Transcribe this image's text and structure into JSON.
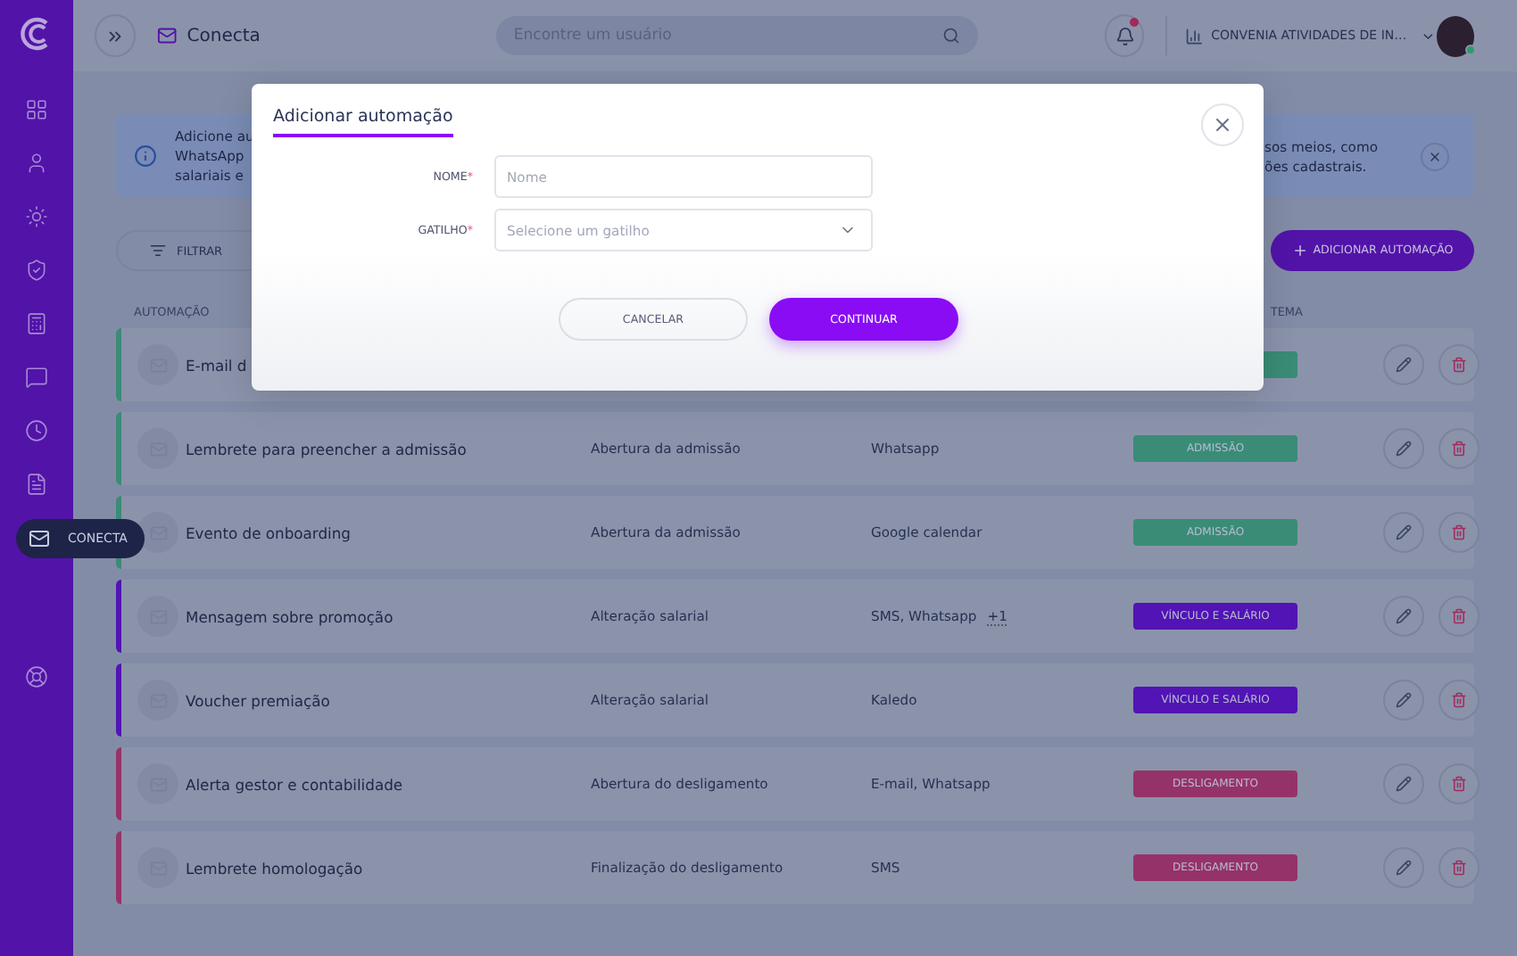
{
  "sidebar": {
    "tooltip": "CONECTA"
  },
  "header": {
    "title": "Conecta",
    "search": {
      "placeholder": "Encontre um usuário"
    },
    "notifications": {
      "unread": true
    },
    "company": "CONVENIA ATIVIDADES DE IN…",
    "avatar": {
      "online": true
    }
  },
  "banner": {
    "left_lines": [
      "Adicione au",
      "WhatsApp",
      "salariais e"
    ],
    "right_lines": [
      "sos meios, como",
      "ões cadastrais."
    ]
  },
  "toolbar": {
    "filter_label": "FILTRAR",
    "add_button": "ADICIONAR AUTOMAÇÃO"
  },
  "table": {
    "columns": [
      {
        "label": "AUTOMAÇÃO"
      },
      {
        "label": "TEMA"
      }
    ],
    "rows": [
      {
        "name": "E-mail d",
        "color": "#3a8c76"
      },
      {
        "name": "Lembrete para preencher a admissão",
        "trigger": "Abertura da admissão",
        "channels": "Whatsapp",
        "tag": "ADMISSÃO",
        "color": "#3a8c76"
      },
      {
        "name": "Evento de onboarding",
        "trigger": "Abertura da admissão",
        "channels": "Google calendar",
        "tag": "ADMISSÃO",
        "color": "#3a8c76"
      },
      {
        "name": "Mensagem sobre promoção",
        "trigger": "Alteração salarial",
        "channels": "SMS, Whatsapp",
        "extra": "+1",
        "tag": "VÍNCULO E SALÁRIO",
        "color": "#5214b4"
      },
      {
        "name": "Voucher premiação",
        "trigger": "Alteração salarial",
        "channels": "Kaledo",
        "tag": "VÍNCULO E SALÁRIO",
        "color": "#5214b4"
      },
      {
        "name": "Alerta gestor e contabilidade",
        "trigger": "Abertura do desligamento",
        "channels": "E-mail, Whatsapp",
        "tag": "DESLIGAMENTO",
        "color": "#96326a"
      },
      {
        "name": "Lembrete homologação",
        "trigger": "Finalização do desligamento",
        "channels": "SMS",
        "tag": "DESLIGAMENTO",
        "color": "#96326a"
      }
    ]
  },
  "modal": {
    "title": "Adicionar automação",
    "fields": [
      {
        "kind": "text",
        "label": "NOME",
        "required_mark": "*",
        "placeholder": "Nome"
      },
      {
        "kind": "select",
        "label": "GATILHO",
        "required_mark": "*",
        "placeholder": "Selecione um gatilho"
      }
    ],
    "buttons": [
      {
        "kind": "secondary",
        "label": "CANCELAR"
      },
      {
        "kind": "primary",
        "label": "CONTINUAR"
      }
    ]
  }
}
